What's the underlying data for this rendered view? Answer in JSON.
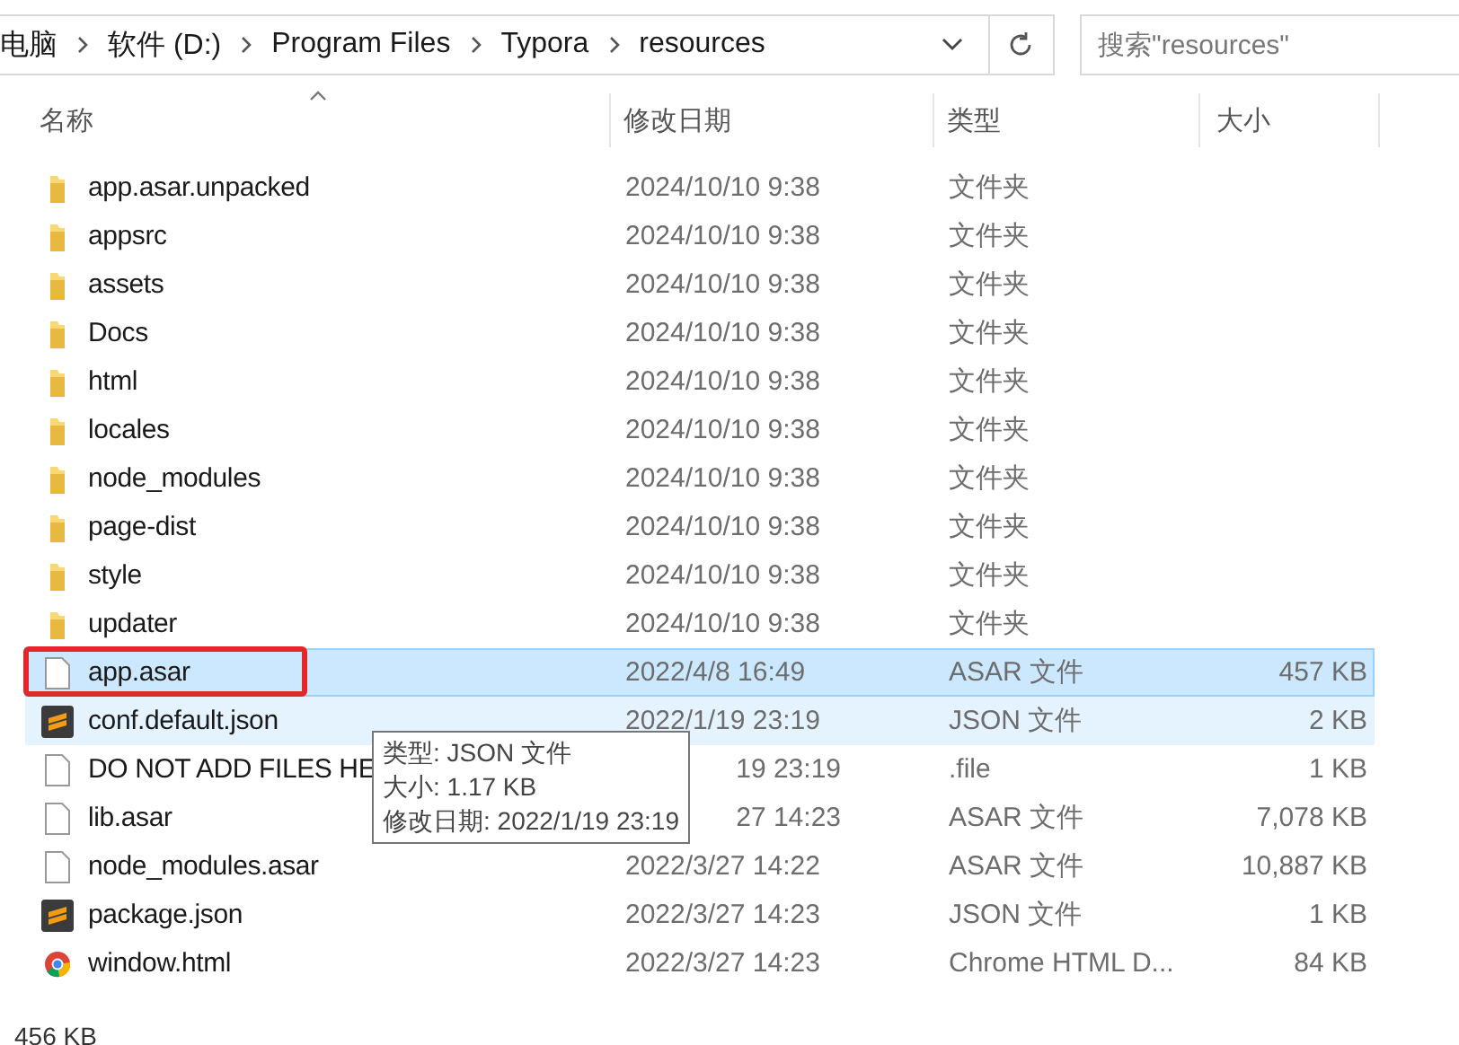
{
  "address_bar": {
    "crumbs": [
      "电脑",
      "软件 (D:)",
      "Program Files",
      "Typora",
      "resources"
    ]
  },
  "search": {
    "placeholder": "搜索\"resources\""
  },
  "columns": [
    {
      "label": "名称",
      "sorted": true
    },
    {
      "label": "修改日期",
      "sorted": false
    },
    {
      "label": "类型",
      "sorted": false
    },
    {
      "label": "大小",
      "sorted": false
    }
  ],
  "rows": [
    {
      "kind": "folder",
      "name": "app.asar.unpacked",
      "date": "2024/10/10 9:38",
      "type": "文件夹",
      "selected": false,
      "hovered": false
    },
    {
      "kind": "folder",
      "name": "appsrc",
      "date": "2024/10/10 9:38",
      "type": "文件夹",
      "selected": false,
      "hovered": false
    },
    {
      "kind": "folder",
      "name": "assets",
      "date": "2024/10/10 9:38",
      "type": "文件夹",
      "selected": false,
      "hovered": false
    },
    {
      "kind": "folder",
      "name": "Docs",
      "date": "2024/10/10 9:38",
      "type": "文件夹",
      "selected": false,
      "hovered": false
    },
    {
      "kind": "folder",
      "name": "html",
      "date": "2024/10/10 9:38",
      "type": "文件夹",
      "selected": false,
      "hovered": false
    },
    {
      "kind": "folder",
      "name": "locales",
      "date": "2024/10/10 9:38",
      "type": "文件夹",
      "selected": false,
      "hovered": false
    },
    {
      "kind": "folder",
      "name": "node_modules",
      "date": "2024/10/10 9:38",
      "type": "文件夹",
      "selected": false,
      "hovered": false
    },
    {
      "kind": "folder",
      "name": "page-dist",
      "date": "2024/10/10 9:38",
      "type": "文件夹",
      "selected": false,
      "hovered": false
    },
    {
      "kind": "folder",
      "name": "style",
      "date": "2024/10/10 9:38",
      "type": "文件夹",
      "selected": false,
      "hovered": false
    },
    {
      "kind": "folder",
      "name": "updater",
      "date": "2024/10/10 9:38",
      "type": "文件夹",
      "selected": false,
      "hovered": false
    },
    {
      "kind": "file",
      "name": "app.asar",
      "date": "2022/4/8 16:49",
      "type": "ASAR 文件",
      "size": "457 KB",
      "selected": true,
      "hovered": false,
      "annotated": true
    },
    {
      "kind": "json",
      "name": "conf.default.json",
      "date": "2022/1/19 23:19",
      "type": "JSON 文件",
      "size": "2 KB",
      "selected": false,
      "hovered": true
    },
    {
      "kind": "file",
      "name": "DO NOT ADD FILES HE",
      "date": "19 23:19",
      "date_partly_hidden": true,
      "type": ".file",
      "size": "1 KB",
      "selected": false,
      "hovered": false
    },
    {
      "kind": "file",
      "name": "lib.asar",
      "date": "27 14:23",
      "date_partly_hidden": true,
      "type": "ASAR 文件",
      "size": "7,078 KB",
      "selected": false,
      "hovered": false
    },
    {
      "kind": "file",
      "name": "node_modules.asar",
      "date": "2022/3/27 14:22",
      "type": "ASAR 文件",
      "size": "10,887 KB",
      "selected": false,
      "hovered": false
    },
    {
      "kind": "json",
      "name": "package.json",
      "date": "2022/3/27 14:23",
      "type": "JSON 文件",
      "size": "1 KB",
      "selected": false,
      "hovered": false
    },
    {
      "kind": "html",
      "name": "window.html",
      "date": "2022/3/27 14:23",
      "type": "Chrome HTML D...",
      "size": "84 KB",
      "selected": false,
      "hovered": false
    }
  ],
  "tooltip": {
    "lines": [
      "类型: JSON 文件",
      "大小: 1.17 KB",
      "修改日期: 2022/1/19 23:19"
    ]
  },
  "status_bar": {
    "text": "456 KB"
  }
}
